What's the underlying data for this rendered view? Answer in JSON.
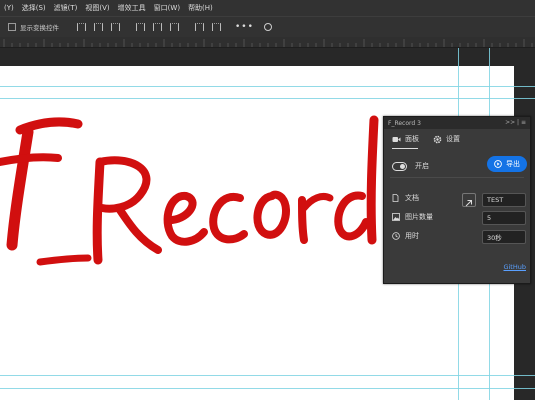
{
  "menubar": {
    "items": [
      "(Y)",
      "选择(S)",
      "滤镜(T)",
      "视图(V)",
      "增效工具",
      "窗口(W)",
      "帮助(H)"
    ]
  },
  "optionsbar": {
    "show_transform_label": "显示变换控件",
    "more_label": "•••"
  },
  "artwork": {
    "text": "F_Record"
  },
  "panel": {
    "title": "F_Record 3",
    "header_controls": ">> | ≡",
    "tabs": {
      "panel_label": "面板",
      "settings_label": "设置"
    },
    "toggle_label": "开启",
    "toggle_on": true,
    "export_label": "导出",
    "fields": {
      "doc_label": "文档",
      "doc_value": "TEST",
      "count_label": "图片数量",
      "count_value": "5",
      "time_label": "用时",
      "time_value": "30秒"
    },
    "github_label": "GitHub",
    "accent_color": "#1473e6"
  }
}
